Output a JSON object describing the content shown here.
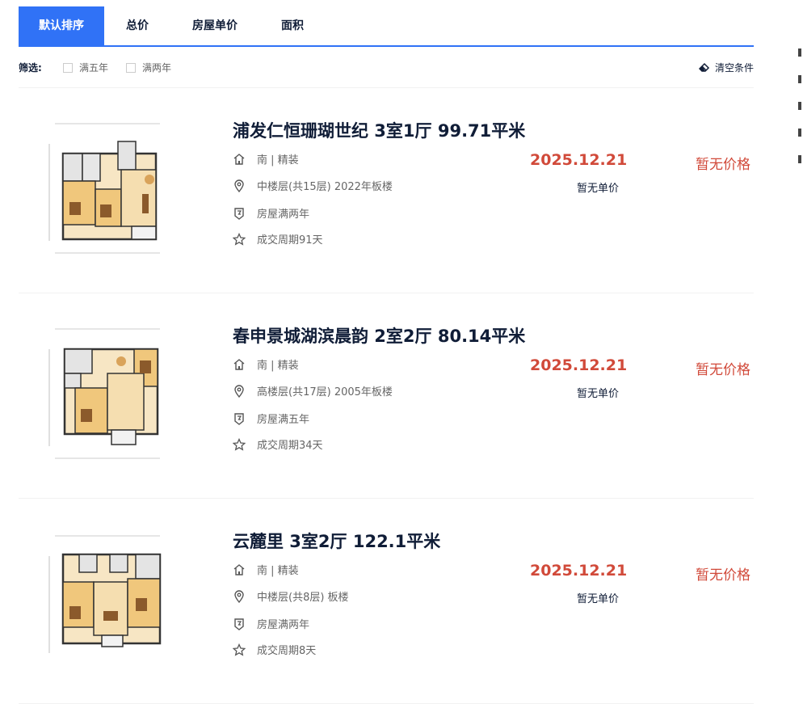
{
  "tabs": [
    {
      "label": "默认排序",
      "active": true
    },
    {
      "label": "总价",
      "active": false
    },
    {
      "label": "房屋单价",
      "active": false
    },
    {
      "label": "面积",
      "active": false
    }
  ],
  "filter": {
    "label": "筛选:",
    "options": [
      "满五年",
      "满两年"
    ],
    "clear_label": "清空条件"
  },
  "listings": [
    {
      "title": "浦发仁恒珊瑚世纪 3室1厅 99.71平米",
      "orientation": "南 | 精装",
      "floor": "中楼层(共15层) 2022年板楼",
      "tag": "房屋满两年",
      "cycle": "成交周期91天",
      "deal_date": "2025.12.21",
      "unit_price": "暂无单价",
      "total_price": "暂无价格"
    },
    {
      "title": "春申景城湖滨晨韵 2室2厅 80.14平米",
      "orientation": "南 | 精装",
      "floor": "高楼层(共17层) 2005年板楼",
      "tag": "房屋满五年",
      "cycle": "成交周期34天",
      "deal_date": "2025.12.21",
      "unit_price": "暂无单价",
      "total_price": "暂无价格"
    },
    {
      "title": "云麓里 3室2厅 122.1平米",
      "orientation": "南 | 精装",
      "floor": "中楼层(共8层) 板楼",
      "tag": "房屋满两年",
      "cycle": "成交周期8天",
      "deal_date": "2025.12.21",
      "unit_price": "暂无单价",
      "total_price": "暂无价格"
    }
  ],
  "colors": {
    "accent": "#3072f6",
    "price_red": "#d14a3a",
    "title_dark": "#101d37"
  }
}
